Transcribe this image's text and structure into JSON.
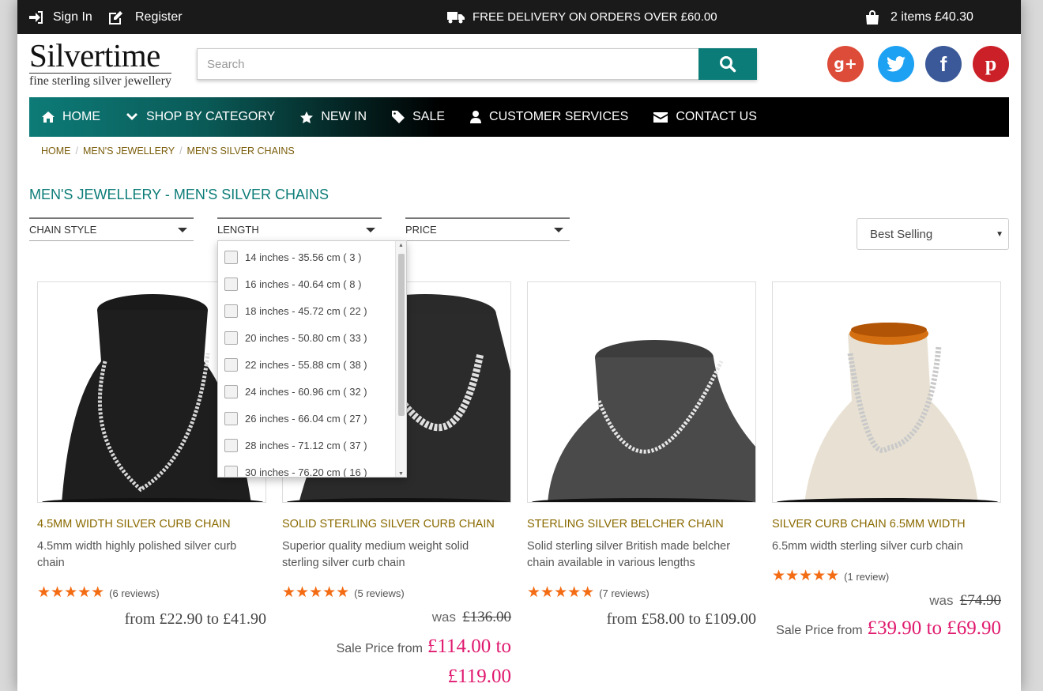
{
  "topbar": {
    "signin": "Sign In",
    "register": "Register",
    "delivery": "FREE DELIVERY ON ORDERS OVER £60.00",
    "cart": "2 items £40.30"
  },
  "logo": {
    "title": "Silvertime",
    "tagline": "fine sterling silver jewellery"
  },
  "search": {
    "placeholder": "Search"
  },
  "social": [
    {
      "label": "g+",
      "color": "#dd4b39"
    },
    {
      "label": "t",
      "color": "#1da1f2"
    },
    {
      "label": "f",
      "color": "#3b5998"
    },
    {
      "label": "p",
      "color": "#cb2027"
    }
  ],
  "nav": {
    "home": "HOME",
    "shop": "SHOP BY CATEGORY",
    "new": "NEW IN",
    "sale": "SALE",
    "customer": "CUSTOMER SERVICES",
    "contact": "CONTACT US"
  },
  "breadcrumb": [
    "HOME",
    "MEN'S JEWELLERY",
    "MEN'S SILVER CHAINS"
  ],
  "page_title": "MEN'S JEWELLERY - MEN'S SILVER CHAINS",
  "filters": {
    "style": "CHAIN STYLE",
    "length": "LENGTH",
    "price": "PRICE"
  },
  "sort": {
    "selected": "Best Selling"
  },
  "length_options": [
    "14 inches - 35.56 cm ( 3 )",
    "16 inches - 40.64 cm ( 8 )",
    "18 inches - 45.72 cm ( 22 )",
    "20 inches - 50.80 cm ( 33 )",
    "22 inches - 55.88 cm ( 38 )",
    "24 inches - 60.96 cm ( 32 )",
    "26 inches - 66.04 cm ( 27 )",
    "28 inches - 71.12 cm ( 37 )",
    "30 inches - 76.20 cm ( 16 )"
  ],
  "products": [
    {
      "name": "4.5MM WIDTH SILVER CURB CHAIN",
      "desc": "4.5mm width highly polished silver curb chain",
      "rating": 5,
      "reviews": "(6 reviews)",
      "price": "from £22.90 to £41.90"
    },
    {
      "name": "SOLID STERLING SILVER CURB CHAIN",
      "desc": "Superior quality medium weight solid sterling silver curb chain",
      "rating": 5,
      "reviews": "(5 reviews)",
      "was_label": "was",
      "was_price": "£136.00",
      "sale_label": "Sale Price from",
      "sale_price": "£114.00 to £119.00"
    },
    {
      "name": "STERLING SILVER BELCHER CHAIN",
      "desc": "Solid sterling silver British made belcher chain available in various lengths",
      "rating": 5,
      "reviews": "(7 reviews)",
      "price": "from £58.00 to £109.00"
    },
    {
      "name": "SILVER CURB CHAIN 6.5MM WIDTH",
      "desc": "6.5mm width sterling silver curb chain",
      "rating": 5,
      "reviews": "(1 review)",
      "was_label": "was",
      "was_price": "£74.90",
      "sale_label": "Sale Price from",
      "sale_price": "£39.90 to £69.90"
    }
  ]
}
